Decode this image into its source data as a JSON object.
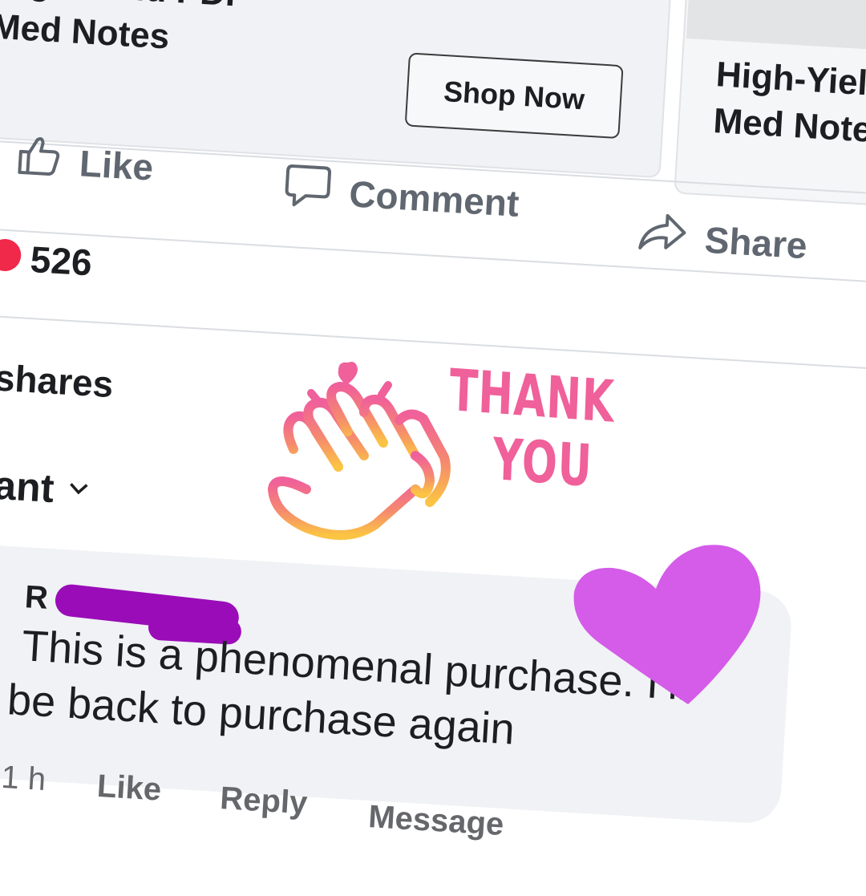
{
  "ad_cards": [
    {
      "title_line1": "High-Yield PDF",
      "title_line2": "Med Notes",
      "cta_label": "Shop Now"
    },
    {
      "title_line1": "High-Yield PDF",
      "title_line2": "Med Notes"
    }
  ],
  "actions": {
    "like": "Like",
    "comment": "Comment",
    "share": "Share"
  },
  "stats": {
    "reaction_count": "526",
    "shares_label": "shares"
  },
  "sort": {
    "label": "Most relevant"
  },
  "sticker": {
    "line1": "THANK",
    "line2": "YOU"
  },
  "comment": {
    "author_initial": "R",
    "text_line1": "This is a phenomenal purchase. I’ll",
    "text_line2": "be back to purchase again",
    "time": "1 h",
    "like_label": "Like",
    "reply_label": "Reply",
    "message_label": "Message"
  },
  "colors": {
    "reaction_red": "#f02849",
    "sticker_pink": "#f0609a",
    "heart_purple": "#d45ce8",
    "redaction_purple": "#9a0cb8"
  }
}
